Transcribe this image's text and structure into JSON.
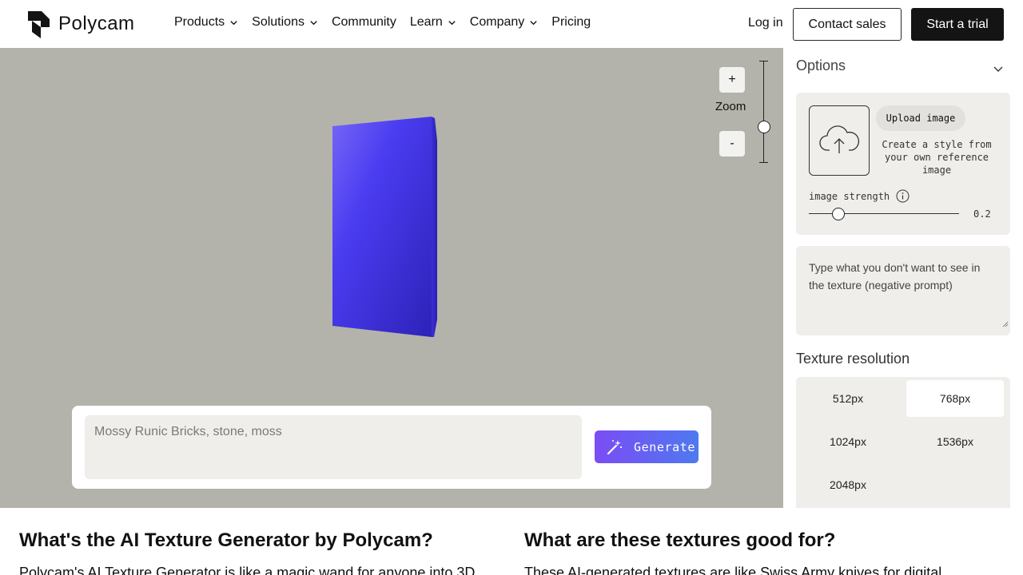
{
  "brand": {
    "name": "Polycam"
  },
  "nav": {
    "items": [
      {
        "label": "Products",
        "dropdown": true
      },
      {
        "label": "Solutions",
        "dropdown": true
      },
      {
        "label": "Community",
        "dropdown": false
      },
      {
        "label": "Learn",
        "dropdown": true
      },
      {
        "label": "Company",
        "dropdown": true
      },
      {
        "label": "Pricing",
        "dropdown": false
      }
    ],
    "login": "Log in",
    "contact": "Contact sales",
    "trial": "Start a trial"
  },
  "viewport": {
    "zoom_plus": "+",
    "zoom_label": "Zoom",
    "zoom_minus": "-",
    "background_color": "#b3b3ab",
    "model_color": "#3a2fe0"
  },
  "prompt": {
    "placeholder": "Mossy Runic Bricks, stone, moss",
    "generate_label": "Generate"
  },
  "options": {
    "title": "Options",
    "upload_label": "Upload image",
    "upload_desc": "Create a style from your own reference image",
    "strength_label": "image strength",
    "strength_value": "0.2",
    "negative_placeholder": "Type what you don't want to see in the texture (negative prompt)",
    "resolution_title": "Texture resolution",
    "resolutions": [
      {
        "label": "512px",
        "selected": false
      },
      {
        "label": "768px",
        "selected": true
      },
      {
        "label": "1024px",
        "selected": false
      },
      {
        "label": "1536px",
        "selected": false
      },
      {
        "label": "2048px",
        "selected": false
      }
    ]
  },
  "info": {
    "left_title": "What's the AI Texture Generator by Polycam?",
    "left_text": "Polycam's AI Texture Generator is like a magic wand for anyone into 3D",
    "right_title": "What are these textures good for?",
    "right_text": "These AI-generated textures are like Swiss Army knives for digital"
  }
}
